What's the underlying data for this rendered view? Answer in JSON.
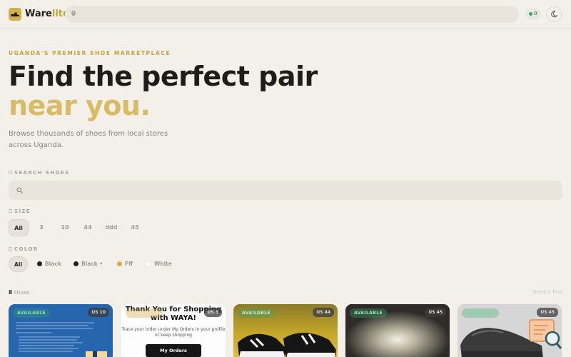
{
  "header": {
    "brand_part1": "Ware",
    "brand_part2": "lite",
    "location_placeholder": "",
    "cart_count": "0"
  },
  "hero": {
    "eyebrow": "UGANDA'S PREMIER SHOE MARKETPLACE",
    "title_line1": "Find the perfect pair",
    "title_line2": "near you.",
    "subtitle": "Browse thousands of shoes from local stores across Uganda."
  },
  "filters": {
    "search_label": "SEARCH SHOES",
    "search_placeholder": "",
    "size_label": "SIZE",
    "sizes": [
      "All",
      "3",
      "10",
      "44",
      "ddd",
      "45"
    ],
    "color_label": "COLOR",
    "colors": [
      {
        "label": "All",
        "dot": null
      },
      {
        "label": "Black",
        "dot": "#222222"
      },
      {
        "label": "Black •",
        "dot": "#222222"
      },
      {
        "label": "Fff",
        "dot": "#d4b04a"
      },
      {
        "label": "White",
        "dot": "#ffffff"
      }
    ]
  },
  "results": {
    "count": "8",
    "count_suffix": " shoes",
    "sort_label": "Newest first"
  },
  "products": [
    {
      "availability": "AVAILABLE",
      "size": "US 10",
      "badge_color": "#3aa66a"
    },
    {
      "availability": "AVAILABLE",
      "size": "US 3",
      "badge_color": "#c9a13a",
      "image_title": "Thank You for Shopping with WAYA!",
      "image_text": "Trace your order under My Orders in your profile or keep shopping",
      "image_button": "My Orders"
    },
    {
      "availability": "AVAILABLE",
      "size": "US 44",
      "badge_color": "#3aa66a"
    },
    {
      "availability": "AVAILABLE",
      "size": "US 45",
      "badge_color": "#3aa66a"
    },
    {
      "availability": "AVAILABLE",
      "size": "US 45",
      "badge_color": "#3aa66a"
    }
  ]
}
